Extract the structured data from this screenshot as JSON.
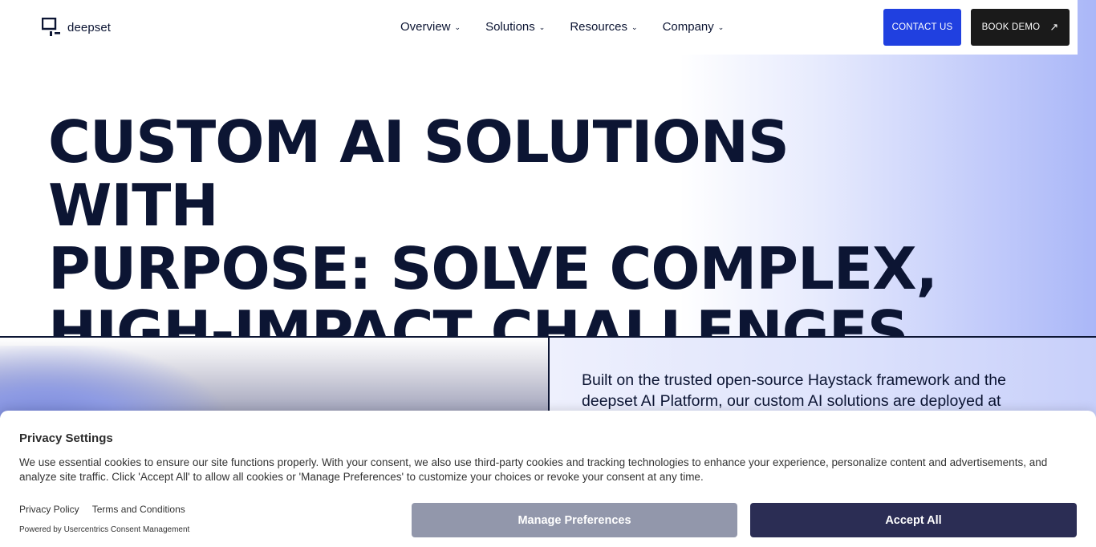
{
  "header": {
    "logo_text": "deepset",
    "nav": [
      {
        "label": "Overview"
      },
      {
        "label": "Solutions"
      },
      {
        "label": "Resources"
      },
      {
        "label": "Company"
      }
    ],
    "contact_label": "CONTACT US",
    "demo_label": "BOOK DEMO"
  },
  "hero": {
    "title_line1": "CUSTOM AI SOLUTIONS WITH",
    "title_line2": "PURPOSE: SOLVE COMPLEX,",
    "title_line3": "HIGH-IMPACT CHALLENGES",
    "description": "Built on the trusted open-source Haystack framework and the deepset AI Platform, our custom AI solutions are deployed at"
  },
  "cookie": {
    "title": "Privacy Settings",
    "body": "We use essential cookies to ensure our site functions properly. With your consent, we also use third-party cookies and tracking technologies to enhance your experience, personalize content and advertisements, and analyze site traffic. Click 'Accept All' to allow all cookies or 'Manage Preferences' to customize your choices or revoke your consent at any time.",
    "privacy_link": "Privacy Policy",
    "terms_link": "Terms and Conditions",
    "powered_by": "Powered by Usercentrics Consent Management",
    "manage_label": "Manage Preferences",
    "accept_label": "Accept All"
  },
  "colors": {
    "primary_text": "#0c1533",
    "contact_button": "#2040e0",
    "demo_button": "#1a1a1a",
    "accept_button": "#2b2d54",
    "manage_button": "#9297ab"
  }
}
